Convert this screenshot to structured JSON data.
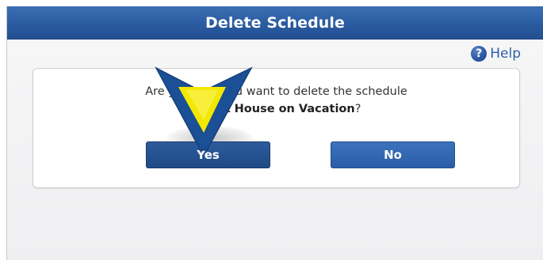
{
  "dialog": {
    "title": "Delete Schedule",
    "help_label": "Help",
    "message": {
      "prefix": "Are you sure you want to delete the schedule",
      "schedule_name": "Check House on Vacation",
      "suffix": "?"
    },
    "buttons": {
      "yes_label": "Yes",
      "no_label": "No"
    }
  },
  "colors": {
    "titlebar": "#2a5ba0",
    "button_primary": "#1f4a86",
    "help_text": "#2f5fa8",
    "pointer_blue": "#1b4f96",
    "pointer_yellow": "#f2e800"
  },
  "icons": {
    "help": "question-circle-icon",
    "pointer": "tutorial-pointer-arrow-icon"
  }
}
